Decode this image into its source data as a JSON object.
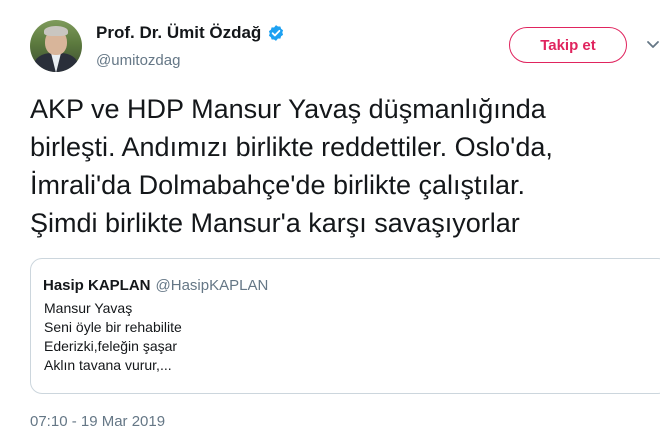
{
  "author": {
    "display_name": "Prof. Dr. Ümit Özdağ",
    "handle": "@umitozdag",
    "verified": true
  },
  "follow_button": {
    "label": "Takip et",
    "color": "#e0245e"
  },
  "tweet": {
    "lines": [
      "AKP ve HDP Mansur Yavaş düşmanlığında",
      "birleşti. Andımızı birlikte reddettiler. Oslo'da,",
      "İmrali'da Dolmabahçe'de birlikte çalıştılar.",
      "Şimdi birlikte Mansur'a karşı savaşıyorlar"
    ],
    "timestamp": "07:10 - 19 Mar 2019"
  },
  "quoted_tweet": {
    "display_name": "Hasip KAPLAN",
    "handle": "@HasipKAPLAN",
    "lines": [
      "Mansur Yavaş",
      "Seni öyle bir rehabilite",
      "Ederizki,feleğin şaşar",
      "Aklın tavana vurur,..."
    ]
  },
  "icons": {
    "verified": "verified-badge-icon",
    "menu": "chevron-down-icon"
  },
  "colors": {
    "accent": "#e0245e",
    "verified": "#1da1f2",
    "secondary_text": "#657786",
    "border": "#ccd6dd"
  }
}
